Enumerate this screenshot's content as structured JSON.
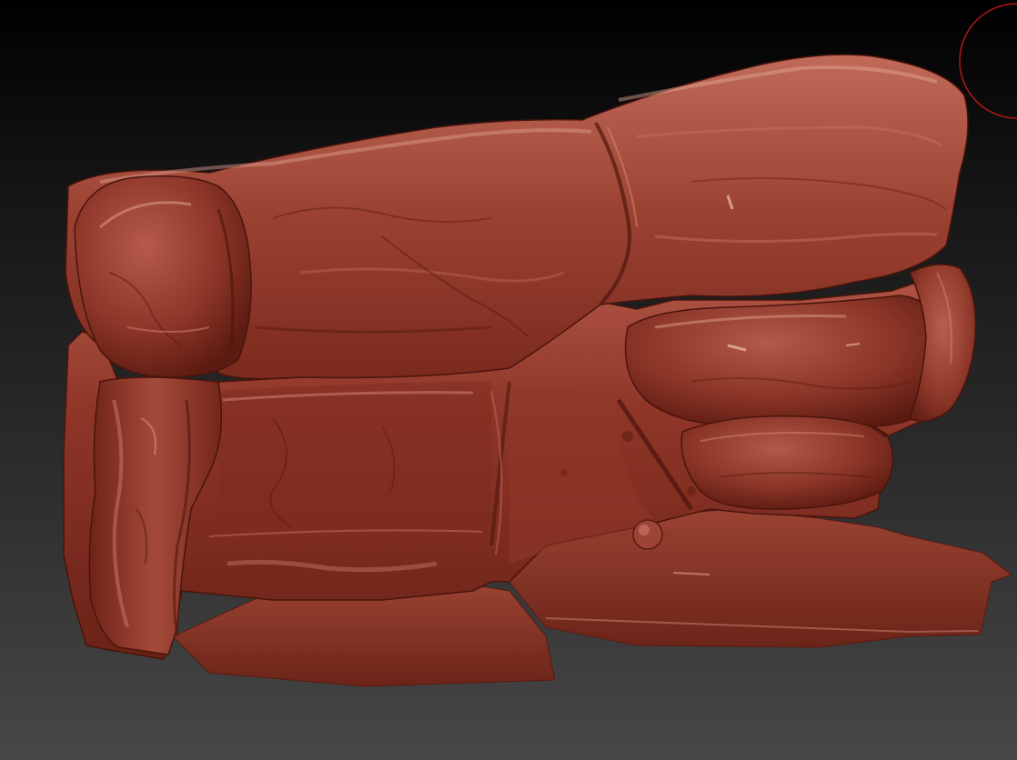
{
  "viewport": {
    "background_top": "#000000",
    "background_bottom": "#474747"
  },
  "model": {
    "material_base": "#8a3224",
    "material_highlight": "#c56a58",
    "material_shadow": "#4a140c",
    "material_specular": "#e8a696"
  },
  "gizmo": {
    "icon": "rotation-gizmo-icon",
    "color": "#b01818"
  }
}
